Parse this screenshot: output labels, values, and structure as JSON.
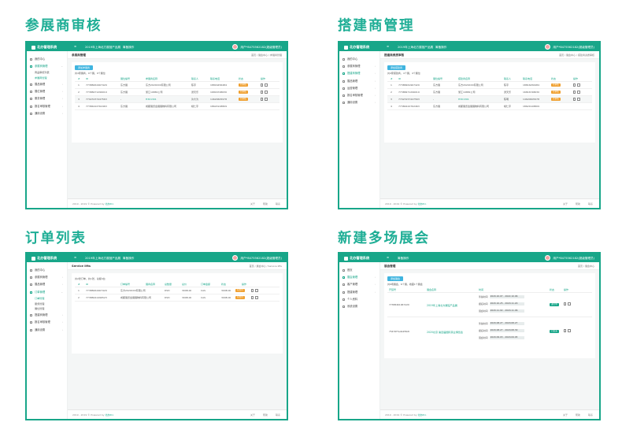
{
  "captions": {
    "p1": "参展商审核",
    "p2": "搭建商管理",
    "p3": "订单列表",
    "p4": "新建多场展会"
  },
  "app": {
    "logo": "北办管理系统",
    "project": "2019年上海北方展馆产品展",
    "selector": "筹备操作",
    "user": "用户*8475562182(超级管理员)",
    "menu_icon": "≡",
    "accent": "#18a689"
  },
  "sidebar": {
    "home": "我的中心",
    "exhibitors": "参展商管理",
    "sub_review": "商品审核列表",
    "sub_manage": "参展商管理",
    "exhibits": "展品管理",
    "booths": "展位管理",
    "services": "服务管理",
    "applications": "运营管理",
    "builders": "搭建商管理",
    "orders": "订单管理",
    "finance": "报名审核管理",
    "settings": "通用设置"
  },
  "p1": {
    "title": "参展商管理",
    "bc": [
      "首页",
      "展会中心",
      "参展商管理"
    ],
    "add": "添加参展商",
    "total": "共4家展商，9个展，9个展位",
    "headers": [
      "#",
      "ID",
      "展位编号",
      "参展商名称",
      "联系人",
      "联系电话",
      "状态",
      "操作"
    ],
    "rows": [
      [
        "1",
        "77388461967429",
        "东方展",
        "东方2020XXX有限公司",
        "陈宇",
        "18816456484",
        "待审核"
      ],
      [
        "2",
        "77388471296019",
        "东方展",
        "浙江19881公司",
        "谭天乐",
        "16816748630",
        "待审核"
      ],
      [
        "3",
        "77023157447563",
        "-",
        "H301301",
        "许大为",
        "14620605978",
        "待审核"
      ],
      [
        "4",
        "77384422762463",
        "东方展",
        "成都展览会展展物料有限公司",
        "姚仁宇",
        "18621918809",
        "待审核"
      ]
    ]
  },
  "p2": {
    "title": "搭建商资质审核",
    "bc": [
      "首页",
      "展会中心",
      "搭建商资质审核"
    ],
    "add": "添加搭建商",
    "total": "共4家搭建商，4个展，4个展位",
    "headers": [
      "#",
      "ID",
      "展位编号",
      "搭建商名称",
      "联系人",
      "联系电话",
      "状态",
      "操作"
    ],
    "rows": [
      [
        "1",
        "77388461967429",
        "东方展",
        "东方2020XXX有限公司",
        "陈宇",
        "18816456484",
        "待审核"
      ],
      [
        "2",
        "77388471296019",
        "东方展",
        "浙江19881公司",
        "谭天乐",
        "16816748630",
        "待审核"
      ],
      [
        "3",
        "77023157447563",
        "-",
        "H301301",
        "陈明",
        "14620605978",
        "待审核"
      ],
      [
        "4",
        "77384422762463",
        "东方展",
        "成都展览会展展物料有限公司",
        "姚仁宇",
        "18621918809",
        "待审核"
      ]
    ]
  },
  "p3": {
    "title": "Service lifts",
    "bc": [
      "首页",
      "展会中心",
      "Service lifts"
    ],
    "total": "共2张订单，共1张，总额4台",
    "headers": [
      "#",
      "ID",
      "订单编号",
      "展商名称",
      "总数量",
      "总价",
      "订单金额",
      "状态",
      "操作"
    ],
    "rows": [
      [
        "1",
        "77388461967429",
        "东方2020XXX有限公司",
        "DVD",
        "3098.00",
        "CAS",
        "3098.00",
        "待支付"
      ],
      [
        "2",
        "77388441496523",
        "成都展览会展展物料有限公司",
        "DVD",
        "3098.00",
        "CAS",
        "3098.00",
        "待支付"
      ]
    ]
  },
  "p4": {
    "title": "展会管理",
    "bc": [
      "首页",
      "展会中心"
    ],
    "add": "添加展会",
    "total": "共6场展会，6个展，收藏1个展会",
    "headers": [
      "开馆号",
      "展会名称",
      "时间",
      "状态",
      "操作"
    ],
    "rows": [
      {
        "id": "77388461967429",
        "name": "2019年上海北方展馆产品展",
        "times": [
          [
            "筹备时间",
            "2020.10.07",
            "2022.10.06"
          ],
          [
            "报名时间",
            "2020.10.25",
            "2020.11.20"
          ],
          [
            "展会时间",
            "2020.11.02",
            "2020.11.06"
          ]
        ],
        "status": "进行中"
      },
      {
        "id": "75476f7a4b2f9b8",
        "name": "2020北京 第四届国际茶业博览会",
        "times": [
          [
            "筹备时间",
            "2020.08.27",
            "2020.08.27"
          ],
          [
            "报名时间",
            "2020.08.27",
            "2020.08.30"
          ],
          [
            "展会时间",
            "2020.09.03",
            "2020.09.05"
          ]
        ],
        "status": "已结束"
      }
    ]
  },
  "p4_sidebar": {
    "home": "首页",
    "activity": "展会管理",
    "users": "客户管理",
    "vendors": "搭建管理",
    "profile": "个人资料",
    "settings": "系统设置"
  },
  "footer": {
    "copy_prefix": "2019 - 2019 © Powered by ",
    "brand": "北办Pro",
    "links": [
      "关于",
      "帮助",
      "联系"
    ]
  }
}
